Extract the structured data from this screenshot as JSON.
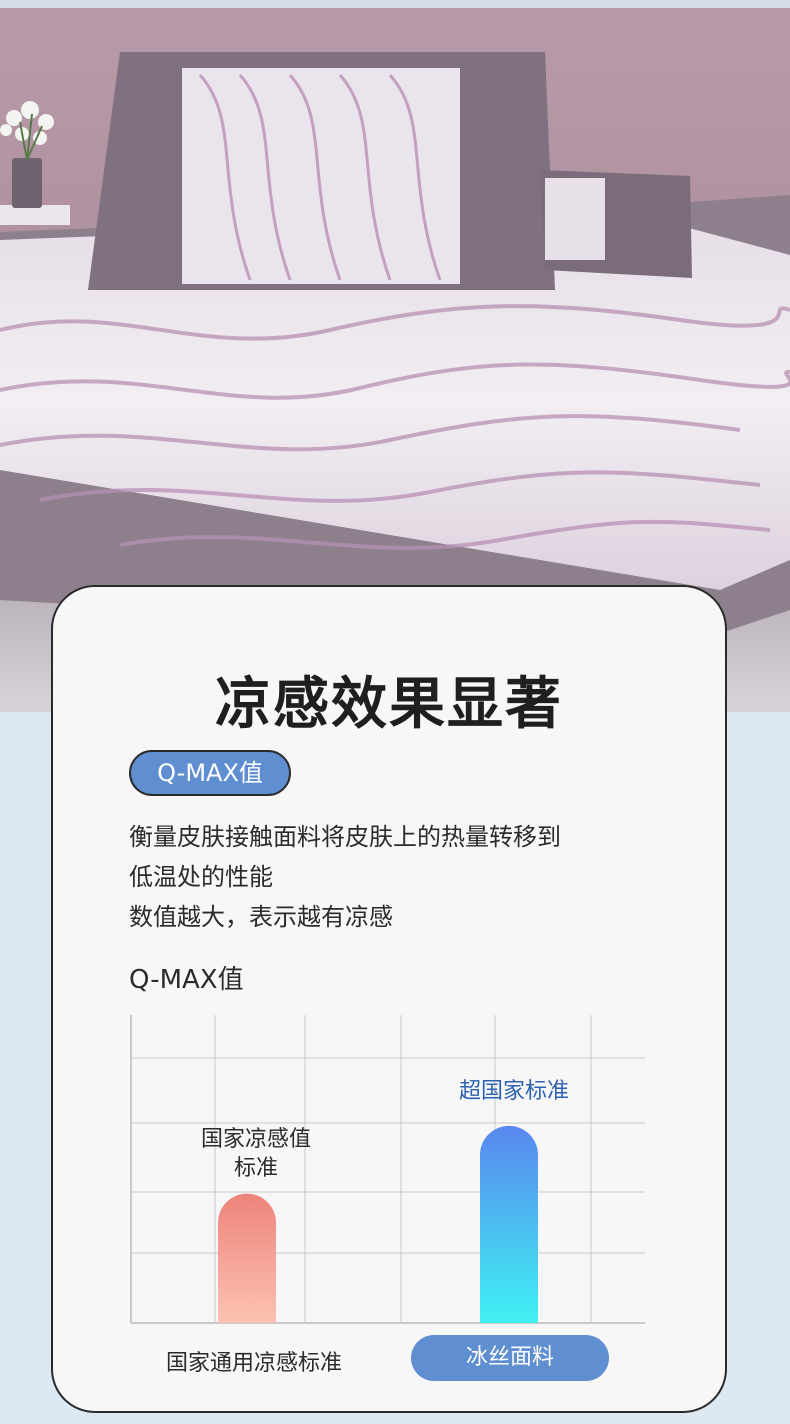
{
  "title": "凉感效果显著",
  "badge": "Q-MAX值",
  "description": [
    "衡量皮肤接触面料将皮肤上的热量转移到",
    "低温处的性能",
    "数值越大，表示越有凉感"
  ],
  "chart_data": {
    "type": "bar",
    "title": "Q-MAX值",
    "categories": [
      "国家通用凉感标准",
      "冰丝面料"
    ],
    "bar_labels": [
      "国家凉感值\n标准",
      "超国家标准"
    ],
    "bar_label_lines": [
      [
        "国家凉感值",
        "标准"
      ],
      [
        "超国家标准"
      ]
    ],
    "values": [
      0.42,
      0.64
    ],
    "ylim": [
      0,
      1
    ],
    "grid": true,
    "colors": {
      "national_top": "#ee837b",
      "national_bottom": "#fcc2b2",
      "fabric_top": "#5a88f0",
      "fabric_bottom": "#3ff0f2"
    }
  },
  "colors": {
    "accent": "#5f8fd0",
    "card_bg": "#f7f7f8",
    "page_bg": "#dde9f2"
  }
}
